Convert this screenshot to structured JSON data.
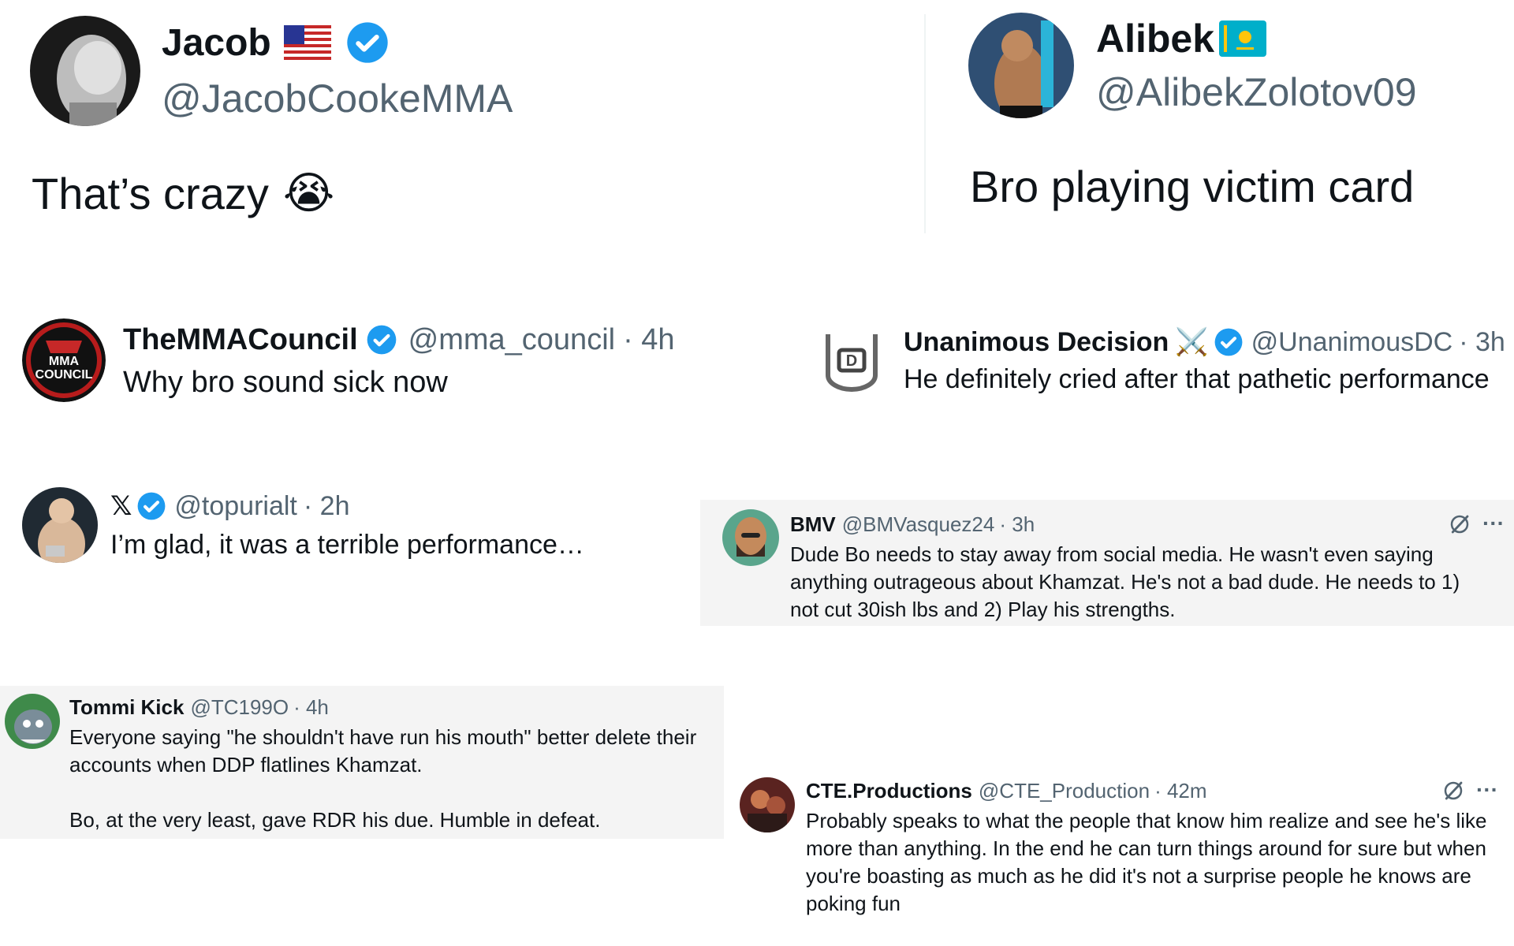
{
  "tweets": [
    {
      "name": "Jacob",
      "flag": "us-flag-icon",
      "handle": "@JacobCookeMMA",
      "text": "That’s crazy",
      "emoji": "😭"
    },
    {
      "name": "Alibek",
      "flag": "kazakhstan-flag-icon",
      "handle": "@AlibekZolotov09",
      "text": "Bro playing victim card"
    },
    {
      "name": "TheMMACouncil",
      "handle": "@mma_council",
      "time": "· 4h",
      "text": "Why bro sound sick now",
      "logo_text": "MMA COUNCIL"
    },
    {
      "name": "Unanimous Decision",
      "name_emoji": "⚔️",
      "handle": "@UnanimousDC",
      "time": "· 3h",
      "text": "He definitely cried after that pathetic performance"
    },
    {
      "name": "𝕏",
      "handle": "@topurialt",
      "time": "· 2h",
      "text": "I’m glad, it was a terrible performance…"
    },
    {
      "name": "BMV",
      "handle": "@BMVasquez24",
      "time": "· 3h",
      "text": "Dude Bo needs to stay away from social media. He wasn't even saying\nanything outrageous about Khamzat.  He's not a bad dude. He needs to 1)\nnot cut 30ish lbs and 2) Play his strengths.",
      "more": "···"
    },
    {
      "name": "Tommi Kick",
      "handle": "@TC199O",
      "time": "· 4h",
      "text": "Everyone saying \"he shouldn't have run his mouth\" better delete their\naccounts when DDP flatlines Khamzat.\n\nBo, at the very least, gave RDR his due. Humble in defeat."
    },
    {
      "name": "CTE.Productions",
      "handle": "@CTE_Production",
      "time": "· 42m",
      "text": "Probably speaks to what the people that know him realize and see he's like\nmore than anything. In the end he can turn things around for sure but when\nyou're boasting as much as he did it's not a surprise people he knows are\npoking fun",
      "more": "···"
    }
  ],
  "colors": {
    "verified": "#1d9bf0",
    "text": "#0f1419",
    "handle": "#536471",
    "panel": "#f4f4f4"
  }
}
